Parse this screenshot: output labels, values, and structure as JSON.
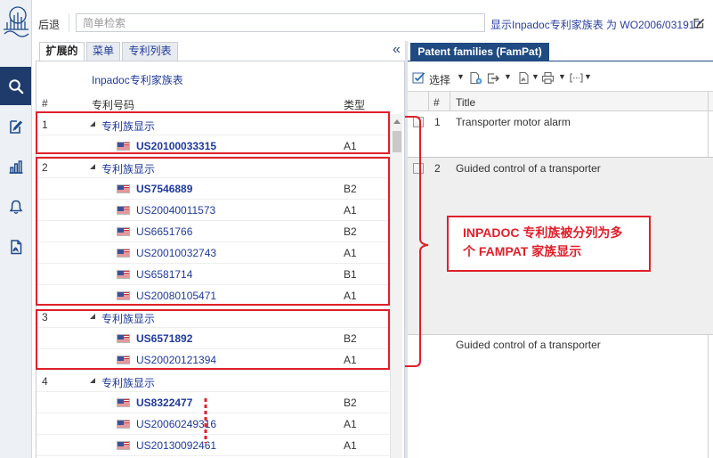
{
  "window": {
    "back_label": "后退"
  },
  "search": {
    "placeholder": "简单检索"
  },
  "header": {
    "display_info": "显示Inpadoc专利家族表 为 WO2006/031917"
  },
  "sidebar": {
    "items": [
      {
        "icon": "search-icon",
        "active": true
      },
      {
        "icon": "edit-document-icon",
        "active": false
      },
      {
        "icon": "bar-chart-icon",
        "active": false
      },
      {
        "icon": "bell-icon",
        "active": false
      },
      {
        "icon": "pdf-document-icon",
        "active": false
      }
    ]
  },
  "left_panel": {
    "tabs": [
      {
        "label": "扩展的",
        "active": true
      },
      {
        "label": "菜单",
        "active": false
      },
      {
        "label": "专利列表",
        "active": false
      }
    ],
    "collapse_label": "«",
    "title": "Inpadoc专利家族表",
    "columns": {
      "number": "#",
      "patent_number": "专利号码",
      "kind": "类型"
    },
    "families": [
      {
        "number": "1",
        "label": "专利族显示",
        "members": [
          {
            "patent_number": "US20100033315",
            "kind": "A1"
          }
        ]
      },
      {
        "number": "2",
        "label": "专利族显示",
        "members": [
          {
            "patent_number": "US7546889",
            "kind": "B2"
          },
          {
            "patent_number": "US20040011573",
            "kind": "A1"
          },
          {
            "patent_number": "US6651766",
            "kind": "B2"
          },
          {
            "patent_number": "US20010032743",
            "kind": "A1"
          },
          {
            "patent_number": "US6581714",
            "kind": "B1"
          },
          {
            "patent_number": "US20080105471",
            "kind": "A1"
          }
        ]
      },
      {
        "number": "3",
        "label": "专利族显示",
        "members": [
          {
            "patent_number": "US6571892",
            "kind": "B2"
          },
          {
            "patent_number": "US20020121394",
            "kind": "A1"
          }
        ]
      },
      {
        "number": "4",
        "label": "专利族显示",
        "members": [
          {
            "patent_number": "US8322477",
            "kind": "B2"
          },
          {
            "patent_number": "US20060249316",
            "kind": "A1"
          },
          {
            "patent_number": "US20130092461",
            "kind": "A1"
          }
        ]
      }
    ]
  },
  "right_panel": {
    "tab_label": "Patent families (FamPat)",
    "toolbar": {
      "select_label": "选择"
    },
    "columns": {
      "number": "#",
      "title": "Title"
    },
    "rows": [
      {
        "number": "1",
        "title": "Transporter motor alarm"
      },
      {
        "number": "2",
        "title": "Guided control of a transporter"
      }
    ],
    "partial_row_title": "Guided control of a transporter"
  },
  "annotation": {
    "callout_lines": [
      "INPADOC  专利族被分列为多",
      "个 FAMPAT 家族显示"
    ]
  },
  "colors": {
    "sidebar_active": "#1e3b6b",
    "tab_active": "#1f4a82",
    "link": "#1e3a9c",
    "annotation_red": "#e0202a"
  }
}
